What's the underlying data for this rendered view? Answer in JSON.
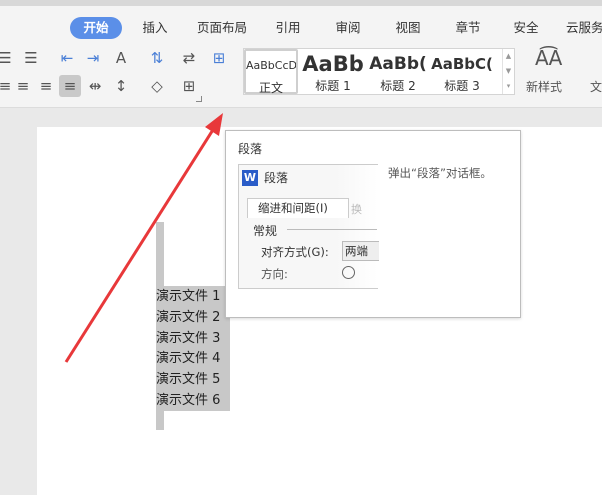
{
  "tabs": [
    "开始",
    "插入",
    "页面布局",
    "引用",
    "审阅",
    "视图",
    "章节",
    "安全",
    "云服务"
  ],
  "styles": [
    {
      "preview": "AaBbCcDd",
      "name": "正文"
    },
    {
      "preview": "AaBb",
      "name": "标题 1"
    },
    {
      "preview": "AaBb(",
      "name": "标题 2"
    },
    {
      "preview": "AaBbC(",
      "name": "标题 3"
    }
  ],
  "new_style": "新样式",
  "text_tool": "文",
  "tooltip": {
    "title": "段落",
    "dialog_title": "段落",
    "tab": "缩进和间距(I)",
    "tab2": "换",
    "section": "常规",
    "align_label": "对齐方式(G):",
    "align_value": "两端",
    "direction_label": "方向:",
    "description": "弹出“段落”对话框。"
  },
  "lines": [
    "演示文件 1",
    "演示文件 2",
    "演示文件 3",
    "演示文件 4",
    "演示文件 5",
    "演示文件 6"
  ],
  "colors": {
    "accent": "#5b8fe8",
    "arrow": "#e8383a"
  }
}
